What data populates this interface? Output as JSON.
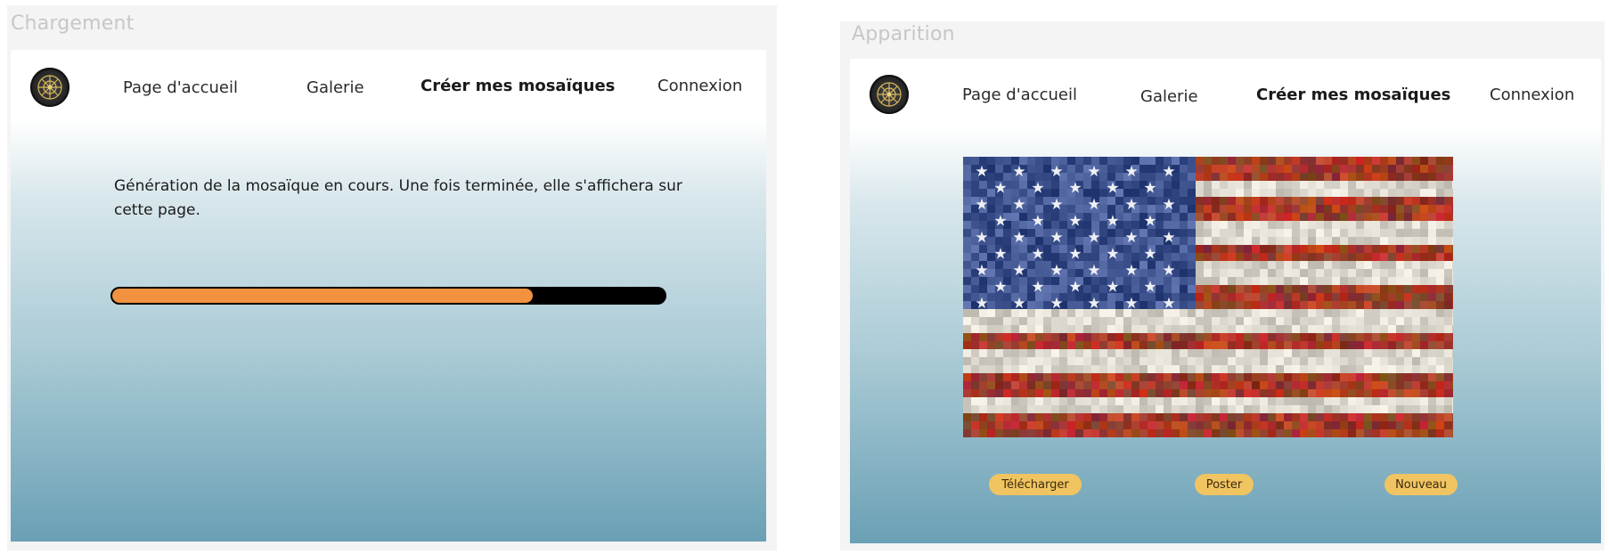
{
  "loading_frame": {
    "label": "Chargement",
    "nav": {
      "logo_icon": "mandala-logo-icon",
      "links": [
        "Page d'accueil",
        "Galerie",
        "Créer mes mosaïques",
        "Connexion"
      ],
      "active_index": 2
    },
    "message": "Génération de la mosaïque en cours. Une fois terminée, elle s'affichera sur cette page.",
    "progress_fraction": 0.76,
    "progress_color": "#f0923f"
  },
  "appearance_frame": {
    "label": "Apparition",
    "nav": {
      "logo_icon": "mandala-logo-icon",
      "links": [
        "Page d'accueil",
        "Galerie",
        "Créer mes mosaïques",
        "Connexion"
      ],
      "active_index": 2
    },
    "mosaic_image": "us-flag-photo-mosaic",
    "buttons": {
      "download": "Télécharger",
      "post": "Poster",
      "new": "Nouveau"
    },
    "button_color": "#f0c460"
  }
}
